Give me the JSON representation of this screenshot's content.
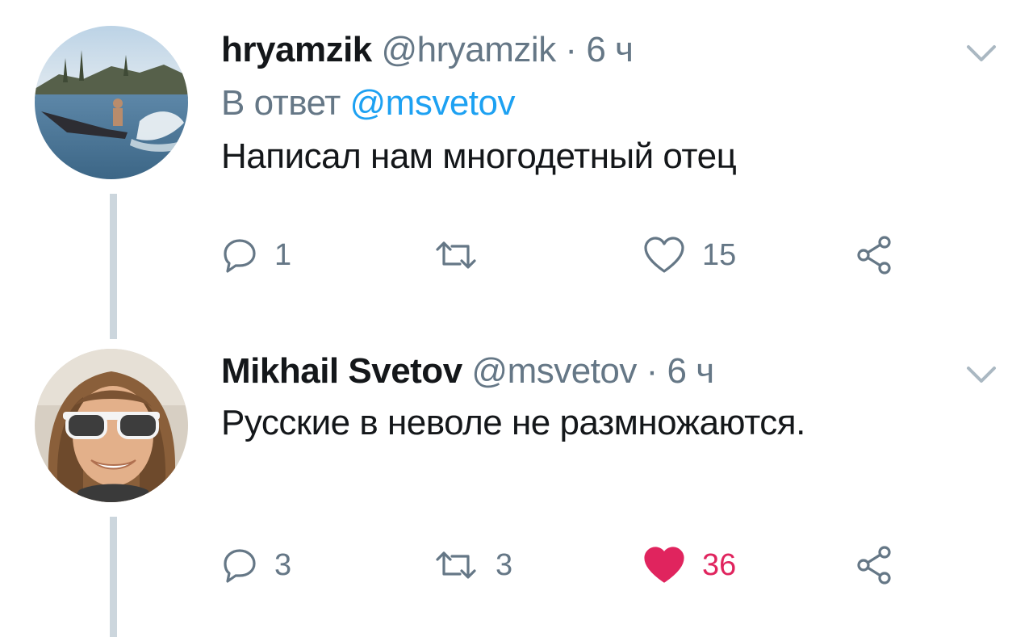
{
  "thread": {
    "tweets": [
      {
        "name": "hryamzik",
        "handle": "@hryamzik",
        "separator": "·",
        "time": "6 ч",
        "reply_label": "В ответ",
        "reply_mention": "@msvetov",
        "text": "Написал нам многодетный отец",
        "replies": "1",
        "retweets": "",
        "likes": "15",
        "liked": false
      },
      {
        "name": "Mikhail Svetov",
        "handle": "@msvetov",
        "separator": "·",
        "time": "6 ч",
        "text": "Русские в неволе не размножаются.",
        "replies": "3",
        "retweets": "3",
        "likes": "36",
        "liked": true
      }
    ]
  },
  "colors": {
    "primary_text": "#14171a",
    "secondary_text": "#657786",
    "link": "#1da1f2",
    "like_active": "#e0245e",
    "thread_line": "#ccd6dd"
  },
  "icons": {
    "reply": "reply-icon",
    "retweet": "retweet-icon",
    "like": "heart-icon",
    "share": "share-icon",
    "menu": "chevron-down-icon"
  }
}
